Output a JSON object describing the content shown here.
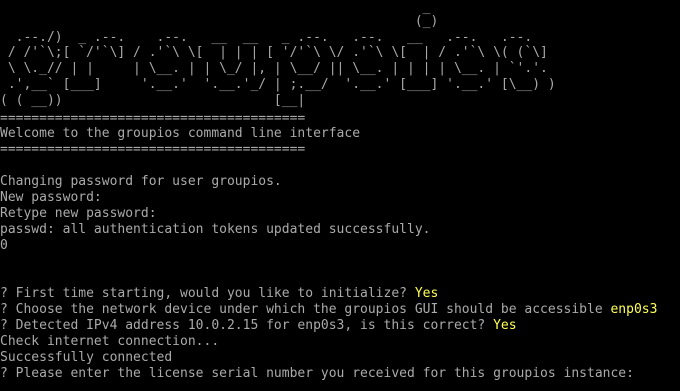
{
  "banner": [
    "                                                      _",
    "                                                     (_)",
    "  .--./)  _ .--.    .--.   __  __   _ .--.   .--.   __   .--.   .--.",
    " / /'`\\;[ `/'`\\] / .'`\\ \\[  | | | [ '/'`\\ \\/ .'`\\ \\[  | / .'`\\ \\( (`\\]",
    " \\ \\._// | |     | \\__. | | \\_/ |, | \\__/ || \\__. | | | | \\__. | `'.'.",
    " .',__` [___]     '.__.'  '.__.'_/ | ;.__/  '.__.' [___] '.__.' [\\__) )",
    "( ( __))                           [__|"
  ],
  "rule": "=======================================",
  "welcome": "Welcome to the groupios command line interface",
  "passwd_lines": [
    "Changing password for user groupios.",
    "New password:",
    "Retype new password:",
    "passwd: all authentication tokens updated successfully.",
    "0"
  ],
  "prompts": [
    {
      "q": "? First time starting, would you like to initialize? ",
      "a": "Yes"
    },
    {
      "q": "? Choose the network device under which the groupios GUI should be accessible ",
      "a": "enp0s3"
    },
    {
      "q": "? Detected IPv4 address 10.0.2.15 for enp0s3, is this correct? ",
      "a": "Yes"
    }
  ],
  "status_lines": [
    "Check internet connection...",
    "Successfully connected"
  ],
  "license_prompt": "? Please enter the license serial number you received for this groupios instance:"
}
